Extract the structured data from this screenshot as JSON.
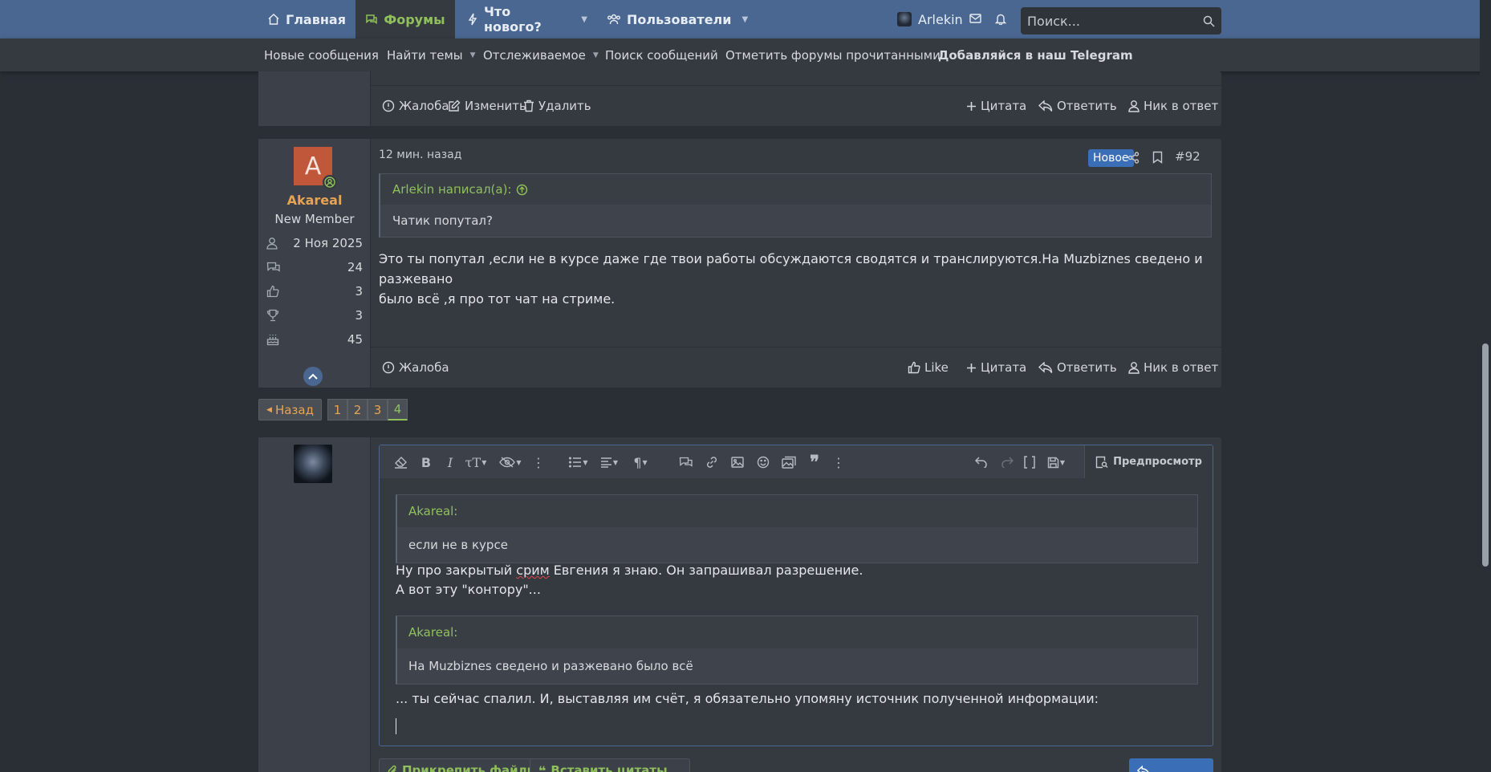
{
  "colors": {
    "nav_bg": "#4a6791",
    "accent_green": "#8fc05b",
    "accent_orange": "#e6a352",
    "badge_blue": "#3a6fb8",
    "page_bg": "#2a2f36",
    "block_bg": "#353a41"
  },
  "nav": {
    "home": "Главная",
    "forums": "Форумы",
    "whats_new": "Что нового?",
    "members": "Пользователи",
    "username": "Arlekin",
    "search_placeholder": "Поиск..."
  },
  "subnav": {
    "new_posts": "Новые сообщения",
    "find_threads": "Найти темы",
    "watched": "Отслеживаемое",
    "search_posts": "Поиск сообщений",
    "mark_read": "Отметить форумы прочитанными",
    "telegram": "Добавляйся в наш Telegram"
  },
  "prev_post": {
    "actions": {
      "report": "Жалоба",
      "edit": "Изменить",
      "delete": "Удалить",
      "quote": "Цитата",
      "reply": "Ответить",
      "nick_reply": "Ник в ответ"
    }
  },
  "post": {
    "avatar_letter": "A",
    "username": "Akareal",
    "user_title": "New Member",
    "stats": {
      "joined": "2 Ноя 2025",
      "messages": "24",
      "reactions": "3",
      "points": "3",
      "age": "45"
    },
    "date": "12 мин. назад",
    "badge": "Новое",
    "number": "#92",
    "quote": {
      "author": "Arlekin написал(а):",
      "text": "Чатик попутал?"
    },
    "body_line1": "Это ты попутал ,если не в курсе даже где твои работы обсуждаются сводятся и транслируются.На Muzbiznes сведено и разжевано",
    "body_line2": "было всё ,я про тот чат на стриме.",
    "actions": {
      "report": "Жалоба",
      "like": "Like",
      "quote": "Цитата",
      "reply": "Ответить",
      "nick_reply": "Ник в ответ"
    }
  },
  "pagination": {
    "back": "Назад",
    "pages": [
      "1",
      "2",
      "3",
      "4"
    ],
    "current": "4"
  },
  "editor": {
    "preview": "Предпросмотр",
    "quote1": {
      "author": "Akareal:",
      "text": "если не в курсе"
    },
    "line1_before": "Ну про закрытый ",
    "line1_spell": "срим",
    "line1_after": " Евгения я знаю. Он запрашивал разрешение.",
    "line2": "А вот эту \"контору\"...",
    "quote2": {
      "author": "Akareal:",
      "text": "На Muzbiznes сведено и разжевано было всё"
    },
    "line3": "... ты сейчас спалил. И, выставляя им счёт, я обязательно упомяну источник полученной информации:",
    "attach_files": "Прикрепить файлы",
    "insert_quotes": "Вставить цитаты..."
  }
}
